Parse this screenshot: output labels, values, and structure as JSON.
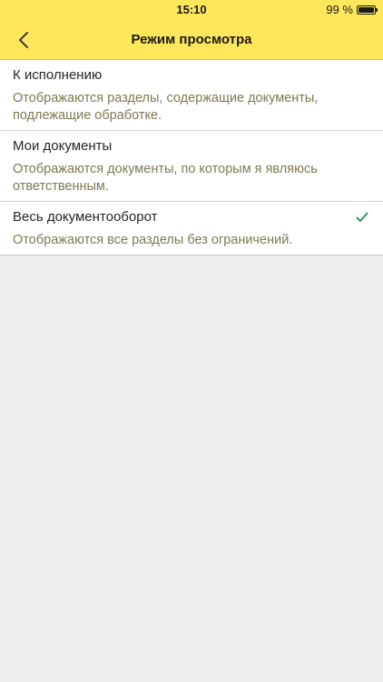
{
  "status_bar": {
    "time": "15:10",
    "battery": "99 %",
    "battery_level": 0.99
  },
  "nav": {
    "back_icon": "chevron-left-icon",
    "title": "Режим просмотра"
  },
  "options": [
    {
      "title": "К исполнению",
      "description": "Отображаются разделы, содержащие документы, подлежащие обработке.",
      "selected": false
    },
    {
      "title": "Мои документы",
      "description": "Отображаются документы, по которым я являюсь ответственным.",
      "selected": false
    },
    {
      "title": "Весь документооборот",
      "description": "Отображаются все разделы без ограничений.",
      "selected": true
    }
  ],
  "colors": {
    "accent": "#ffe75c",
    "description_text": "#7d7a53",
    "check": "#2e9c4f",
    "background": "#efefef"
  }
}
